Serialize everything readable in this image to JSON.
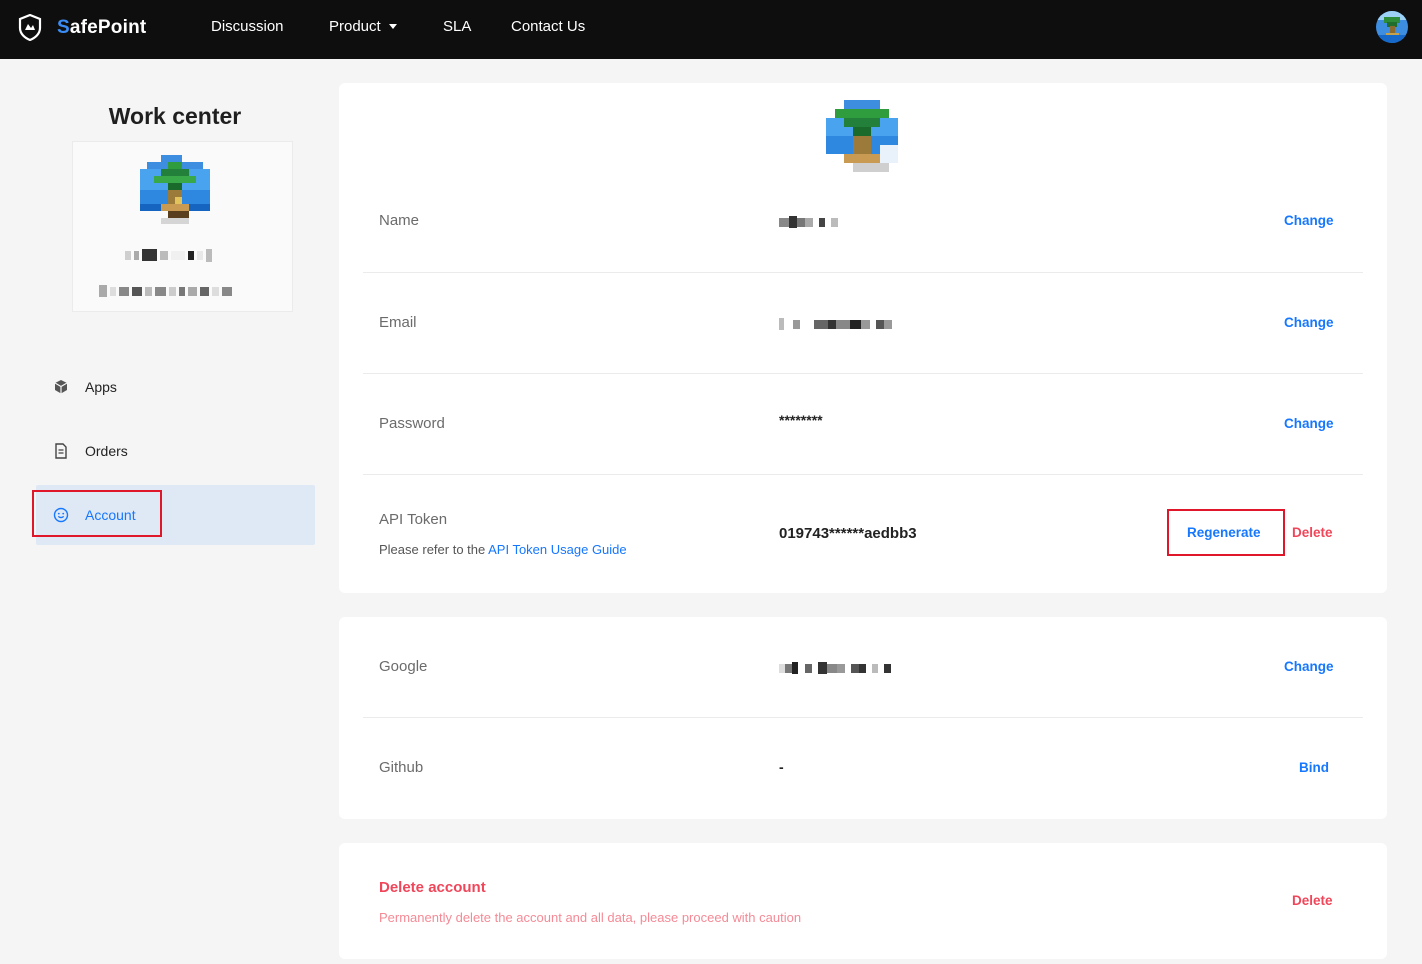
{
  "app": {
    "brand_first": "S",
    "brand_rest": "afePoint"
  },
  "nav": {
    "items": [
      {
        "label": "Discussion"
      },
      {
        "label": "Product"
      },
      {
        "label": "SLA"
      },
      {
        "label": "Contact Us"
      }
    ]
  },
  "sidebar": {
    "title": "Work center",
    "menu": [
      {
        "label": "Apps",
        "icon": "cube-icon"
      },
      {
        "label": "Orders",
        "icon": "document-icon"
      },
      {
        "label": "Account",
        "icon": "smile-icon",
        "active": true
      }
    ]
  },
  "account": {
    "name": {
      "label": "Name",
      "action": "Change"
    },
    "email": {
      "label": "Email",
      "action": "Change"
    },
    "password": {
      "label": "Password",
      "value": "********",
      "action": "Change"
    },
    "api_token": {
      "label": "API Token",
      "hint_prefix": "Please refer to the ",
      "hint_link": "API Token Usage Guide",
      "value": "019743******aedbb3",
      "regenerate": "Regenerate",
      "delete": "Delete"
    }
  },
  "bindings": {
    "google": {
      "label": "Google",
      "action": "Change"
    },
    "github": {
      "label": "Github",
      "value": "-",
      "action": "Bind"
    }
  },
  "danger_zone": {
    "title": "Delete account",
    "description": "Permanently delete the account and all data, please proceed with caution",
    "action": "Delete"
  },
  "colors": {
    "accent": "#1677ff",
    "danger": "#f0465a",
    "highlight_box": "#e0162b",
    "topbar": "#0e0e0e"
  }
}
